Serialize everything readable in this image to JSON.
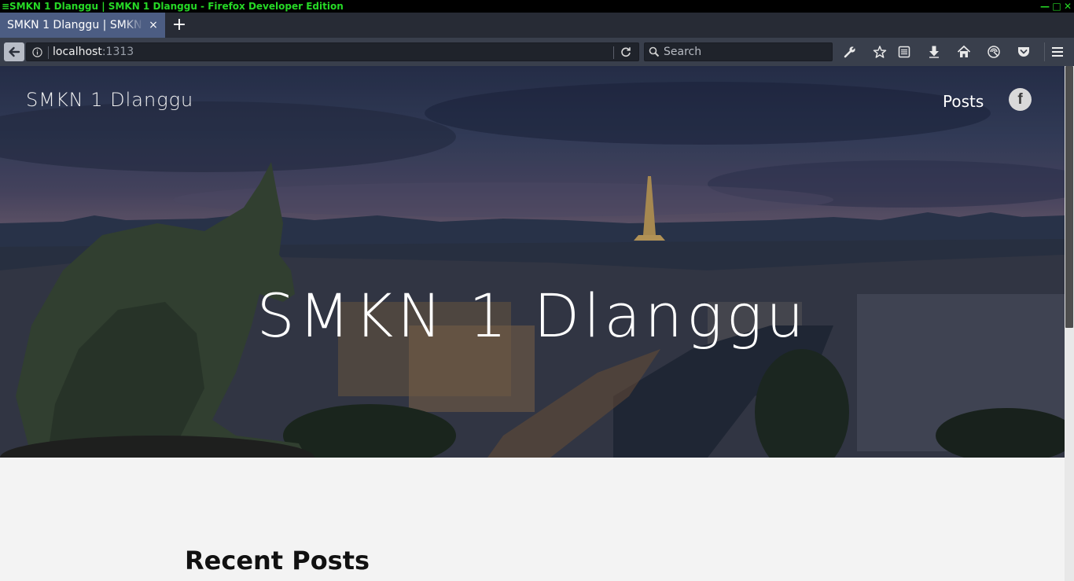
{
  "window": {
    "title": "SMKN 1 Dlanggu | SMKN 1 Dlanggu - Firefox Developer Edition",
    "menu_glyph": "≡",
    "minimize_glyph": "—",
    "maximize_glyph": "□",
    "close_glyph": "✕"
  },
  "tabs": [
    {
      "label": "SMKN 1 Dlanggu | SMKN 1 Dlanggu",
      "active": true,
      "close_glyph": "×"
    }
  ],
  "new_tab_glyph": "+",
  "navbar": {
    "url_host": "localhost",
    "url_port": ":1313",
    "search_placeholder": "Search",
    "icons": [
      "back-arrow-icon",
      "info-icon",
      "reload-icon",
      "search-icon",
      "wrench-icon",
      "bookmark-star-icon",
      "reader-list-icon",
      "download-icon",
      "home-icon",
      "developer-icon",
      "pocket-icon",
      "hamburger-menu-icon"
    ]
  },
  "page": {
    "site_brand": "SMKN 1 Dlanggu",
    "nav": {
      "posts_label": "Posts",
      "facebook_glyph": "f"
    },
    "hero_title": "SMKN 1 Dlanggu",
    "recent_posts_heading": "Recent Posts"
  },
  "colors": {
    "titlebar_text": "#26d926",
    "tab_active": "#4c5d83",
    "toolbar": "#393f4c",
    "page_background": "#f3f3f3"
  }
}
